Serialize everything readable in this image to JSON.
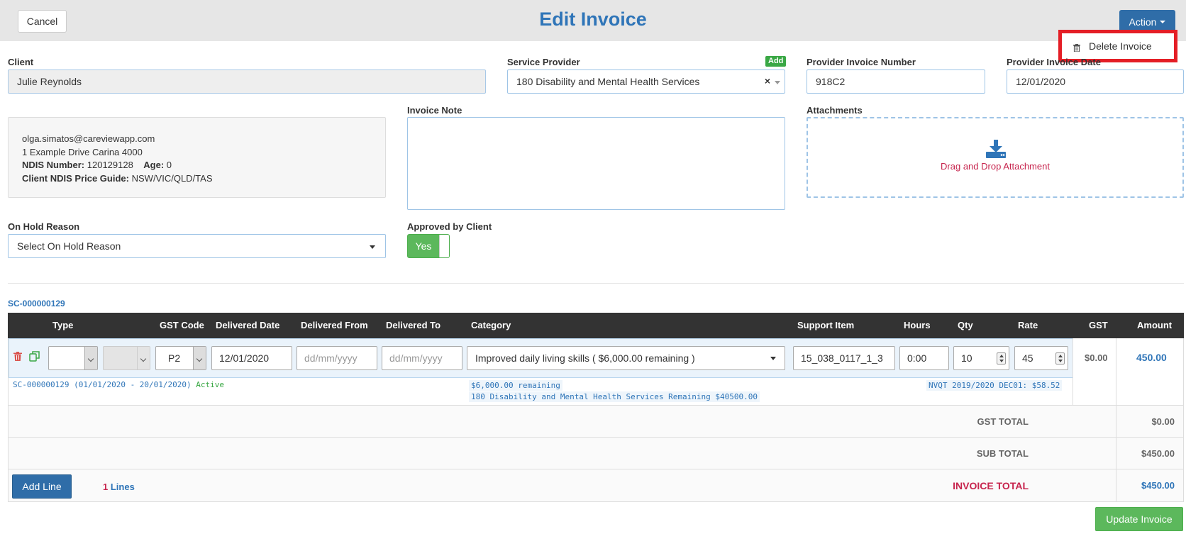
{
  "header": {
    "title": "Edit Invoice",
    "cancel_label": "Cancel",
    "action_label": "Action",
    "dropdown": {
      "delete_label": "Delete Invoice"
    }
  },
  "form": {
    "client_label": "Client",
    "client_value": "Julie Reynolds",
    "service_provider_label": "Service Provider",
    "service_provider_value": "180 Disability and Mental Health Services",
    "add_badge": "Add",
    "provider_invoice_number_label": "Provider Invoice Number",
    "provider_invoice_number_value": "918C2",
    "provider_invoice_date_label": "Provider Invoice Date",
    "provider_invoice_date_value": "12/01/2020",
    "invoice_note_label": "Invoice Note",
    "attachments_label": "Attachments",
    "attachments_drop_text": "Drag and Drop Attachment",
    "on_hold_label": "On Hold Reason",
    "on_hold_value": "Select On Hold Reason",
    "approved_label": "Approved by Client",
    "approved_value": "Yes"
  },
  "client_info": {
    "email": "olga.simatos@careviewapp.com",
    "address": "1 Example Drive Carina 4000",
    "ndis_label": "NDIS Number:",
    "ndis_value": "120129128",
    "age_label": "Age:",
    "age_value": "0",
    "price_guide_label": "Client NDIS Price Guide:",
    "price_guide_value": "NSW/VIC/QLD/TAS"
  },
  "service_contract": "SC-000000129",
  "table": {
    "columns": [
      "Type",
      "GST Code",
      "Delivered Date",
      "Delivered From",
      "Delivered To",
      "Category",
      "Support Item",
      "Hours",
      "Qty",
      "Rate",
      "GST",
      "Amount"
    ],
    "row": {
      "gst_code": "P2",
      "delivered_date": "12/01/2020",
      "delivered_from_placeholder": "dd/mm/yyyy",
      "delivered_to_placeholder": "dd/mm/yyyy",
      "category": "Improved daily living skills ( $6,000.00 remaining )",
      "support_item": "15_038_0117_1_3",
      "hours": "0:00",
      "qty": "10",
      "rate": "45",
      "gst": "$0.00",
      "amount": "450.00",
      "contract_info": "SC-000000129 (01/01/2020 - 20/01/2020)",
      "contract_status": "Active",
      "remaining": "$6,000.00 remaining",
      "provider_remaining": "180 Disability and Mental Health Services Remaining $40500.00",
      "price_info": "NVQT 2019/2020 DEC01: $58.52"
    }
  },
  "totals": {
    "gst_label": "GST TOTAL",
    "gst_value": "$0.00",
    "sub_label": "SUB TOTAL",
    "sub_value": "$450.00",
    "invoice_label": "INVOICE TOTAL",
    "invoice_value": "$450.00"
  },
  "footer": {
    "add_line_label": "Add Line",
    "lines_count": "1",
    "lines_label": "Lines",
    "update_label": "Update Invoice"
  },
  "colors": {
    "brand_blue": "#2f75b8",
    "highlight_red": "#e41e26",
    "success_green": "#5cb85c",
    "danger_red": "#c7254e"
  }
}
